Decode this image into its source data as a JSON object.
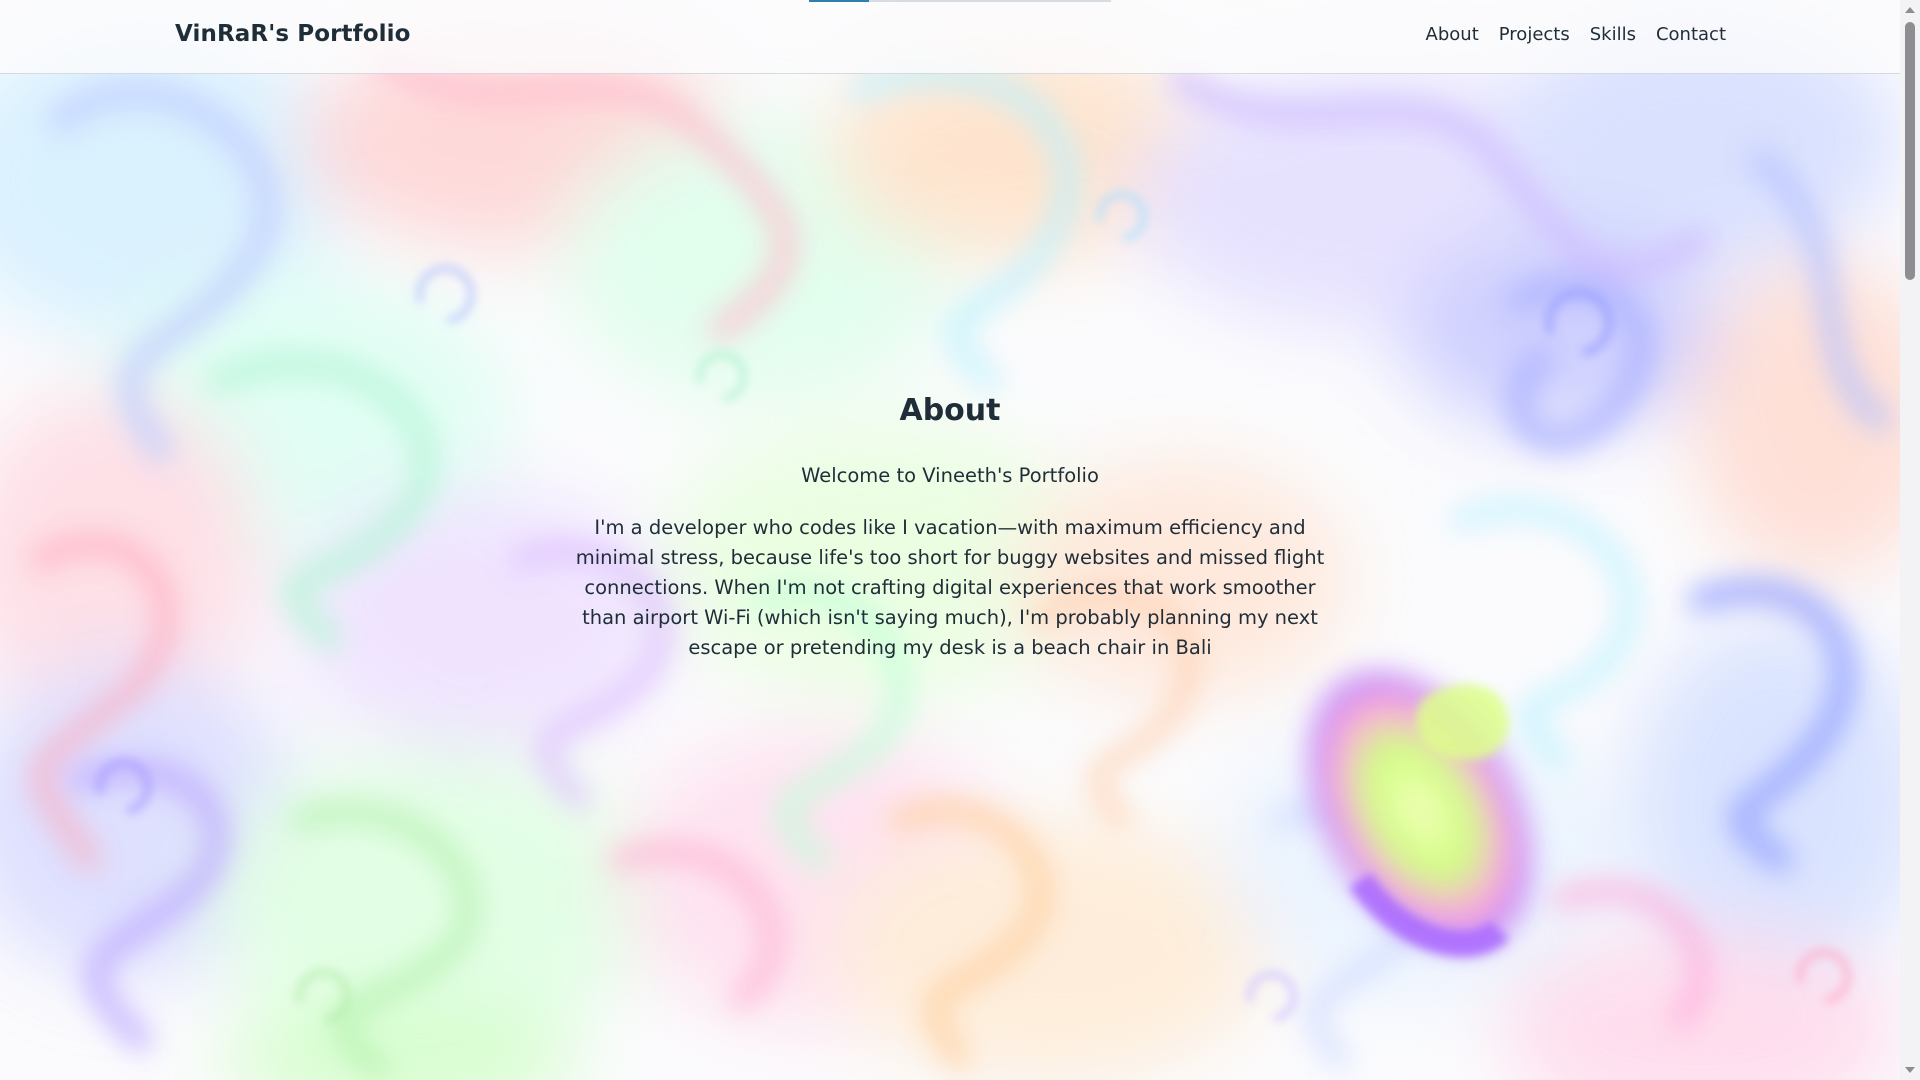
{
  "header": {
    "brand": "VinRaR's Portfolio",
    "scroll_progress": 0.2
  },
  "nav": {
    "items": [
      {
        "label": "About"
      },
      {
        "label": "Projects"
      },
      {
        "label": "Skills"
      },
      {
        "label": "Contact"
      }
    ]
  },
  "about": {
    "title": "About",
    "subtitle": "Welcome to Vineeth's Portfolio",
    "body": "I'm a developer who codes like I vacation—with maximum efficiency and minimal stress, because life's too short for buggy websites and missed flight connections. When I'm not crafting digital experiences that work smoother than airport Wi-Fi (which isn't saying much), I'm probably planning my next escape or pretending my desk is a beach chair in Bali"
  },
  "theme": {
    "text_color": "#1f2d38",
    "accent": "#2f7fae",
    "background": "#fbfbfd",
    "background_palette": [
      "#ffb3c6",
      "#b9c7ff",
      "#aaf5d0",
      "#ffd6a8",
      "#d8b4ff",
      "#b3f0ff",
      "#d4ff9a",
      "#ff9ad4"
    ]
  }
}
